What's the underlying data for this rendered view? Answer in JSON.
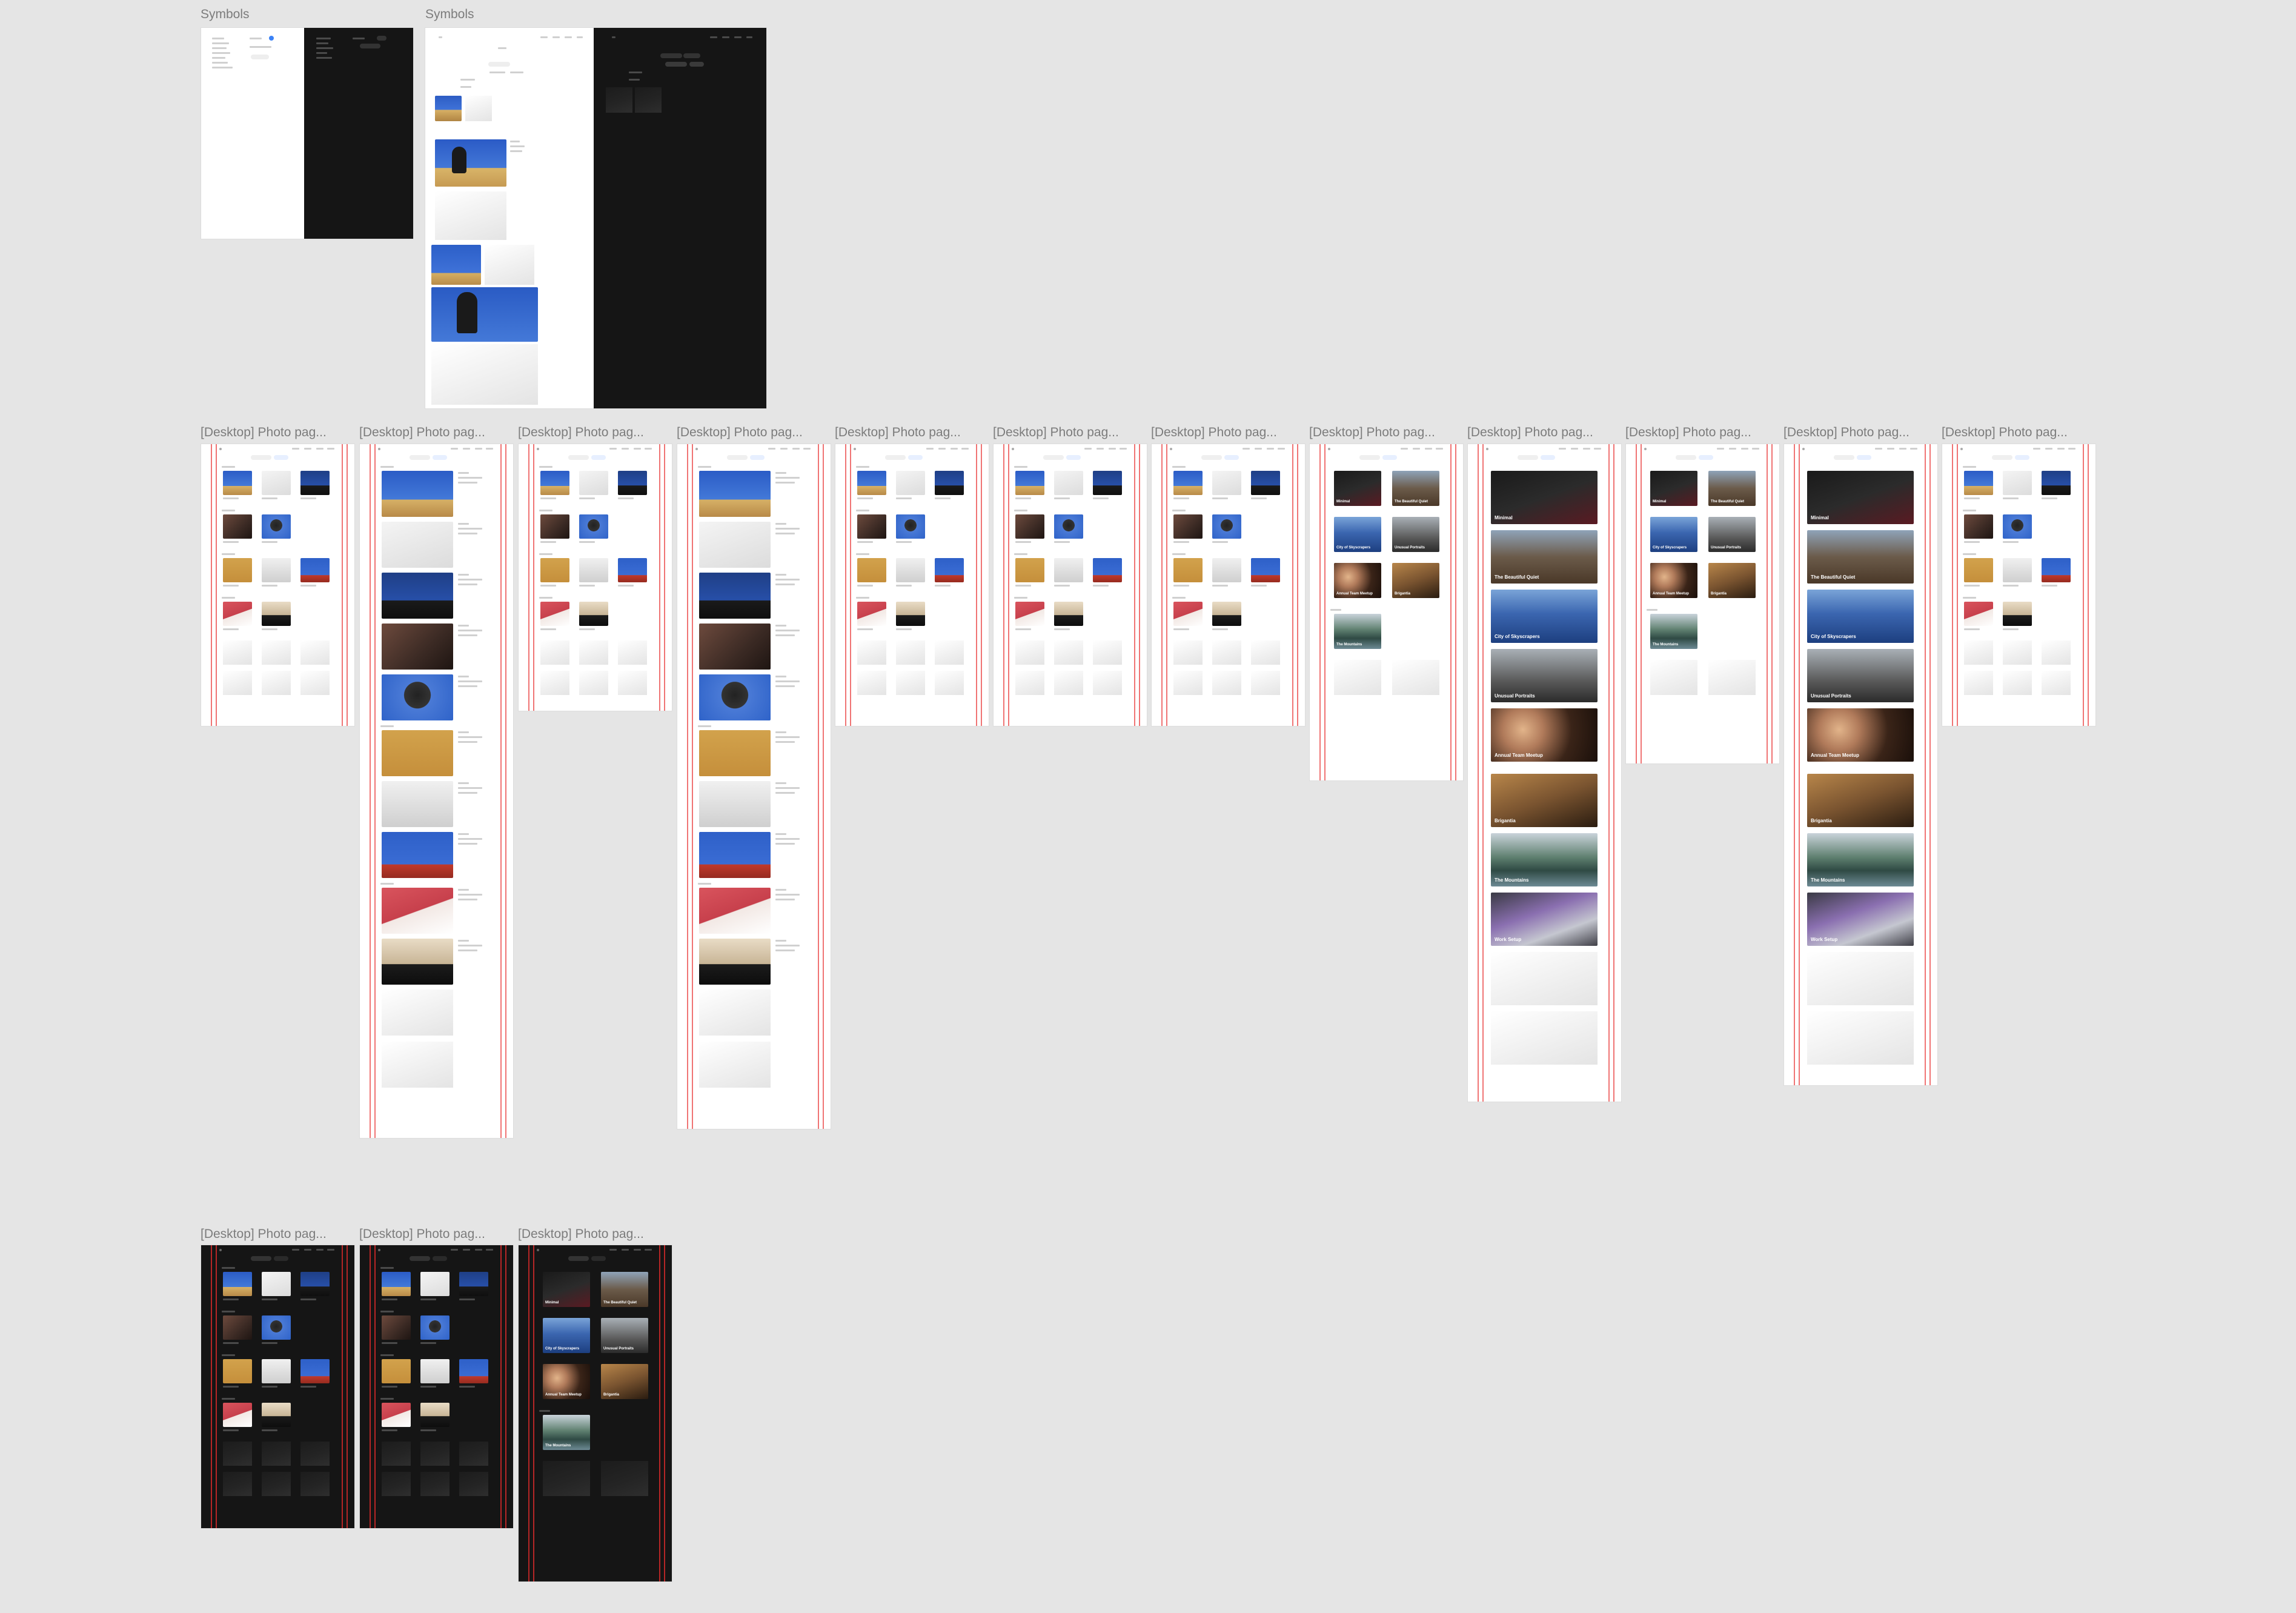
{
  "canvas_labels": {
    "symbols_1": "Symbols",
    "symbols_2": "Symbols",
    "frame": "[Desktop] Photo pag..."
  },
  "album_titles": [
    "Minimal",
    "The Beautiful Quiet",
    "City of Skyscrapers",
    "Unusual Portraits",
    "Annual Team Meetup",
    "Brigantia",
    "The Mountains",
    "Work Setup"
  ],
  "colors": {
    "canvas": "#e5e5e5",
    "label": "#7c7c7c",
    "guide": "#eb4646",
    "light_board": "#ffffff",
    "dark_board": "#151515",
    "accent": "#3b82f6"
  }
}
